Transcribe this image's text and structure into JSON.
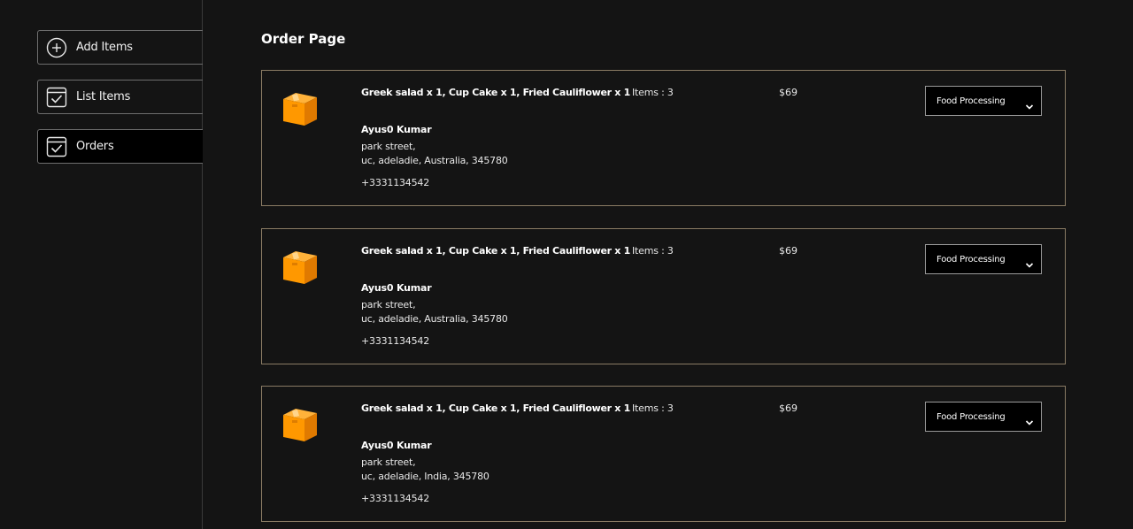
{
  "sidebar": {
    "items": [
      {
        "label": "Add Items",
        "icon": "add-circle-icon"
      },
      {
        "label": "List Items",
        "icon": "checklist-icon"
      },
      {
        "label": "Orders",
        "icon": "checklist-icon",
        "active": true
      }
    ]
  },
  "main": {
    "title": "Order Page",
    "orders": [
      {
        "items_text": "Greek salad x 1, Cup Cake x 1, Fried Cauliflower x 1",
        "customer_name": "Ayus0 Kumar",
        "address_line1": "park street,",
        "address_line2": "uc, adeladie, Australia, 345780",
        "phone": "+3331134542",
        "item_count": "Items : 3",
        "amount": "$69",
        "status": "Food Processing"
      },
      {
        "items_text": "Greek salad x 1, Cup Cake x 1, Fried Cauliflower x 1",
        "customer_name": "Ayus0 Kumar",
        "address_line1": "park street,",
        "address_line2": "uc, adeladie, Australia, 345780",
        "phone": "+3331134542",
        "item_count": "Items : 3",
        "amount": "$69",
        "status": "Food Processing"
      },
      {
        "items_text": "Greek salad x 1, Cup Cake x 1, Fried Cauliflower x 1",
        "customer_name": "Ayus0 Kumar",
        "address_line1": "park street,",
        "address_line2": "uc, adeladie, India, 345780",
        "phone": "+3331134542",
        "item_count": "Items : 3",
        "amount": "$69",
        "status": "Food Processing"
      }
    ]
  },
  "colors": {
    "background": "#141414",
    "card_border": "#8a7b64",
    "parcel_orange": "#ff9800"
  }
}
